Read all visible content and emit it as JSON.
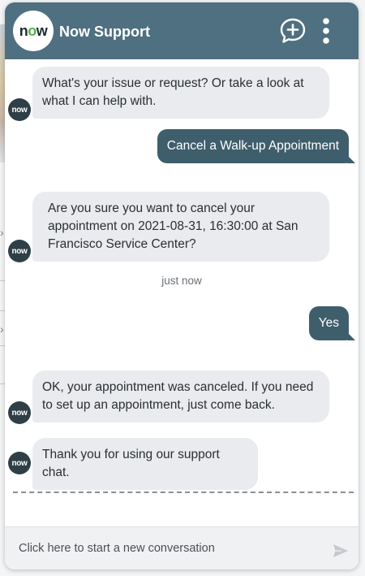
{
  "header": {
    "title": "Now Support",
    "logo_text_n": "n",
    "logo_text_o": "o",
    "logo_text_w": "w",
    "color": "#4f7080"
  },
  "messages": [
    {
      "from": "bot",
      "text": "What's your issue or request? Or take a look at what I can help with."
    },
    {
      "from": "user",
      "text": "Cancel a Walk-up Appointment"
    },
    {
      "from": "bot",
      "text": "Are you sure you want to cancel your appointment on 2021-08-31, 16:30:00 at San Francisco Service Center?"
    },
    {
      "from": "system",
      "text": "just now"
    },
    {
      "from": "user",
      "text": "Yes"
    },
    {
      "from": "bot",
      "text": "OK, your appointment was canceled. If you need to set up an appointment, just come back."
    },
    {
      "from": "bot",
      "text": "Thank you for using our support chat."
    }
  ],
  "avatar_text": "now",
  "footer": {
    "placeholder": "Click here to start a new conversation"
  },
  "icons": {
    "new_chat": "chat-plus-icon",
    "more": "more-vertical-icon",
    "send": "send-icon"
  },
  "colors": {
    "user_bubble": "#3f5e6c",
    "bot_bubble": "#e9ebee"
  }
}
